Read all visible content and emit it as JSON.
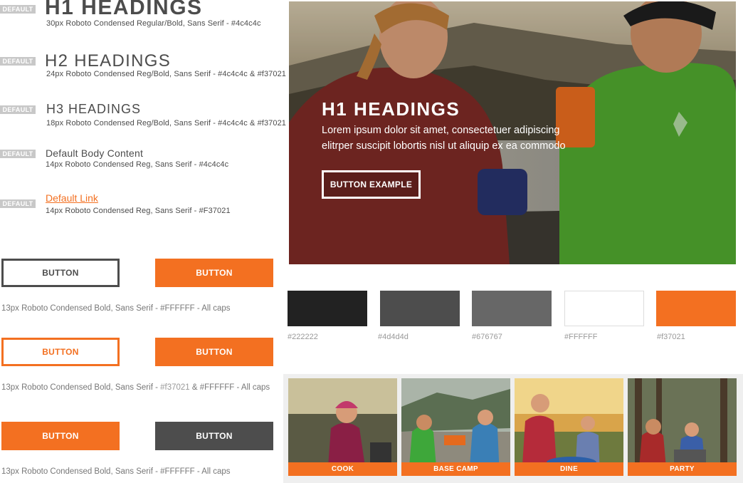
{
  "style_guide": {
    "tag_label": "DEFAULT",
    "h1": {
      "title": "H1 HEADINGS",
      "desc": "30px Roboto Condensed Regular/Bold, Sans Serif - #4c4c4c"
    },
    "h2": {
      "title": "H2 HEADINGS",
      "desc": "24px Roboto Condensed Reg/Bold, Sans Serif - #4c4c4c & #f37021"
    },
    "h3": {
      "title": "H3 HEADINGS",
      "desc": "18px Roboto Condensed Reg/Bold, Sans Serif - #4c4c4c  & #f37021"
    },
    "body": {
      "title": "Default Body Content",
      "desc": "14px Roboto Condensed Reg, Sans Serif - #4c4c4c"
    },
    "link": {
      "title": "Default Link",
      "desc": "14px Roboto Condensed Reg, Sans Serif - #F37021"
    }
  },
  "buttons": {
    "label": "BUTTON",
    "row1_note": "13px Roboto Condensed Bold, Sans Serif - #FFFFFF - All caps",
    "row2_note_a": "13px Roboto Condensed Bold, Sans Serif - ",
    "row2_note_b": "#f37021",
    "row2_note_c": " & #FFFFFF - All caps",
    "row3_note": "13px Roboto Condensed Bold, Sans Serif - #FFFFFF - All caps"
  },
  "hero": {
    "heading": "H1 HEADINGS",
    "line1": "Lorem ipsum dolor sit amet, consectetuer adipiscing",
    "line2": "elitrper suscipit lobortis nisl ut aliquip ex ea commodo",
    "button": "BUTTON EXAMPLE"
  },
  "palette": [
    {
      "hex": "#222222",
      "label": "#222222"
    },
    {
      "hex": "#4d4d4d",
      "label": "#4d4d4d"
    },
    {
      "hex": "#676767",
      "label": "#676767"
    },
    {
      "hex": "#FFFFFF",
      "label": "#FFFFFF"
    },
    {
      "hex": "#f37021",
      "label": "#f37021"
    }
  ],
  "tiles": [
    {
      "label": "COOK"
    },
    {
      "label": "BASE CAMP"
    },
    {
      "label": "DINE"
    },
    {
      "label": "PARTY"
    }
  ],
  "colors": {
    "accent": "#f37021",
    "text": "#4c4c4c",
    "dark": "#4d4d4d"
  }
}
